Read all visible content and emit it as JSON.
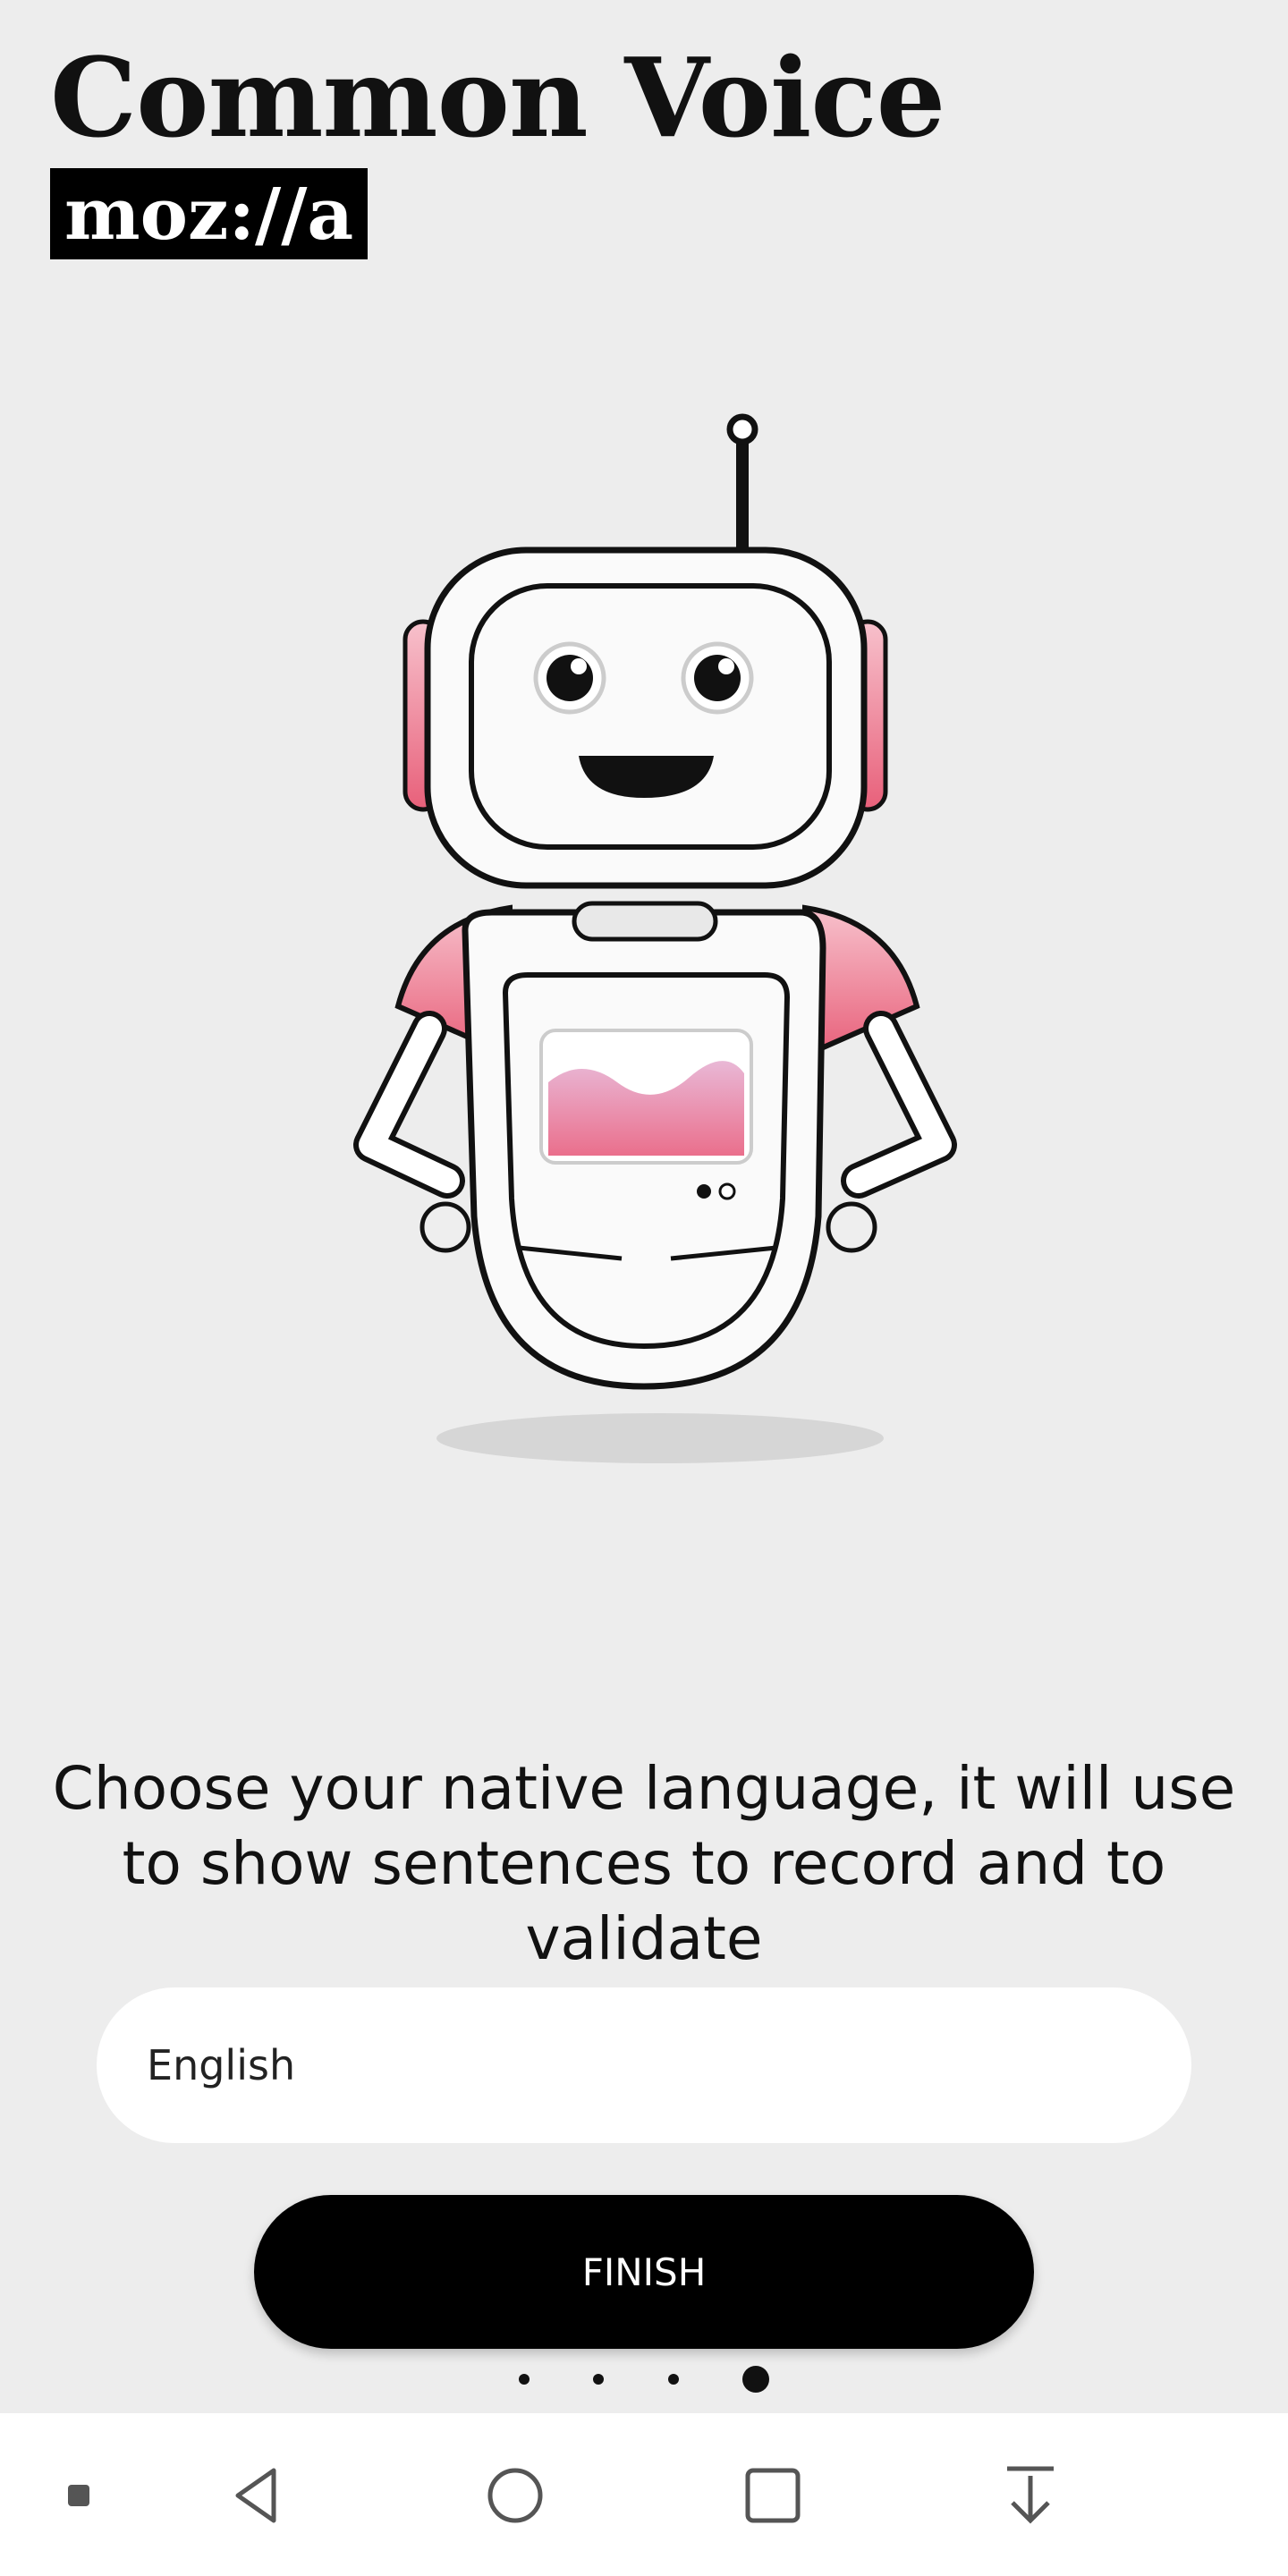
{
  "header": {
    "app_title": "Common Voice",
    "brand_logo": "moz://a"
  },
  "mascot": {
    "name": "robot-mascot-illustration"
  },
  "onboarding": {
    "prompt": "Choose your native language, it will use to show sentences to record and to validate",
    "language_select": {
      "value": "English"
    },
    "finish_label": "FINISH",
    "pager": {
      "total": 4,
      "current": 4
    }
  },
  "navbar": {
    "icons": [
      "menu-square-icon",
      "back-icon",
      "home-icon",
      "recents-icon",
      "download-icon"
    ]
  }
}
